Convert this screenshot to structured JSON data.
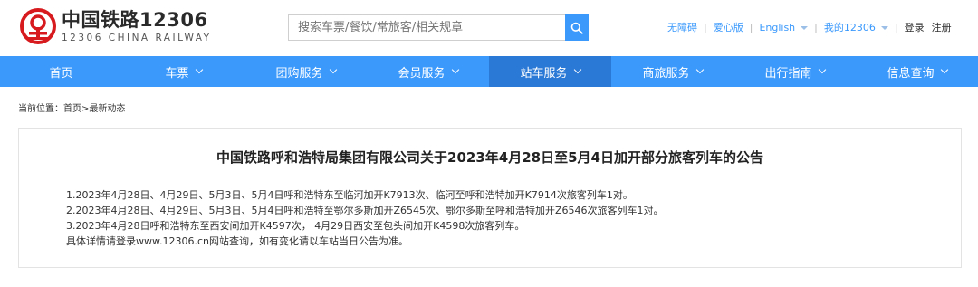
{
  "header": {
    "logo_cn": "中国铁路12306",
    "logo_en": "12306 CHINA RAILWAY",
    "search_placeholder": "搜索车票/餐饮/常旅客/相关规章",
    "links": {
      "accessible": "无障碍",
      "love": "爱心版",
      "english": "English",
      "my12306": "我的12306",
      "login": "登录",
      "register": "注册"
    }
  },
  "nav": {
    "items": [
      {
        "label": "首页",
        "has_dropdown": false
      },
      {
        "label": "车票",
        "has_dropdown": true
      },
      {
        "label": "团购服务",
        "has_dropdown": true
      },
      {
        "label": "会员服务",
        "has_dropdown": true
      },
      {
        "label": "站车服务",
        "has_dropdown": true,
        "active": true
      },
      {
        "label": "商旅服务",
        "has_dropdown": true
      },
      {
        "label": "出行指南",
        "has_dropdown": true
      },
      {
        "label": "信息查询",
        "has_dropdown": true
      }
    ]
  },
  "breadcrumb": {
    "prefix": "当前位置：",
    "home": "首页",
    "separator": ">",
    "current": "最新动态"
  },
  "article": {
    "title": "中国铁路呼和浩特局集团有限公司关于2023年4月28日至5月4日加开部分旅客列车的公告",
    "lines": [
      "1.2023年4月28日、4月29日、5月3日、5月4日呼和浩特东至临河加开K7913次、临河至呼和浩特加开K7914次旅客列车1对。",
      "2.2023年4月28日、4月29日、5月3日、5月4日呼和浩特至鄂尔多斯加开Z6545次、鄂尔多斯至呼和浩特加开Z6546次旅客列车1对。",
      "3.2023年4月28日呼和浩特东至西安间加开K4597次， 4月29日西安至包头间加开K4598次旅客列车。",
      "具体详情请登录www.12306.cn网站查询，如有变化请以车站当日公告为准。"
    ]
  },
  "colors": {
    "brand_red": "#d71a1e",
    "nav_blue": "#3b99fc",
    "nav_active": "#2b79d6"
  },
  "icons": {
    "logo": "railway-logo-icon",
    "search": "search-icon",
    "dropdown": "chevron-down-icon"
  }
}
